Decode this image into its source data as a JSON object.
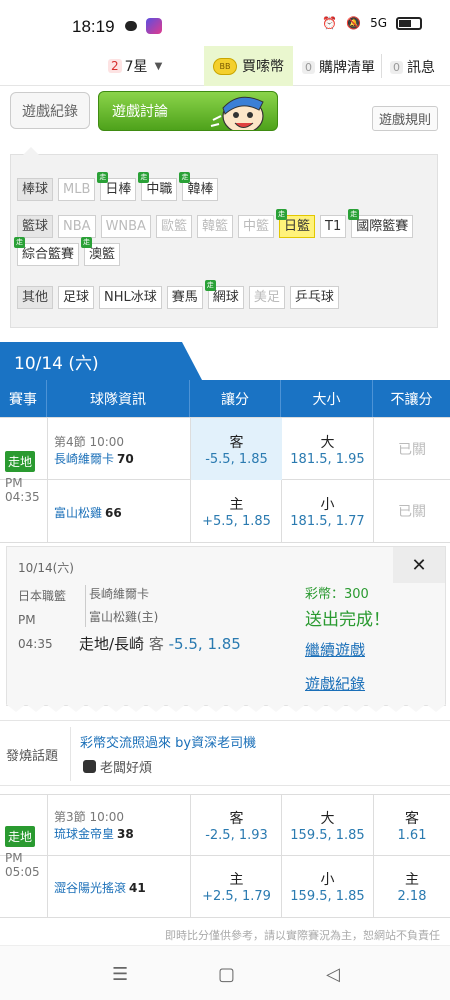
{
  "statusbar": {
    "time": "18:19",
    "signal": "5G"
  },
  "topnav": {
    "stars_count": "2",
    "stars_label": "7星",
    "buy_coin_badge": "BB",
    "buy_label": "買嗦幣",
    "sold_count": "0",
    "sold_label": "購牌清單",
    "msg_count": "0",
    "msg_label": "訊息"
  },
  "actions": {
    "record_label": "遊戲紀錄",
    "discuss_label": "遊戲討論",
    "rules_label": "遊戲規則"
  },
  "filters": {
    "rows": [
      {
        "category": "棒球",
        "items": [
          {
            "label": "MLB",
            "state": "disabled",
            "live": false
          },
          {
            "label": "日棒",
            "state": "normal",
            "live": true
          },
          {
            "label": "中職",
            "state": "normal",
            "live": true
          },
          {
            "label": "韓棒",
            "state": "normal",
            "live": true
          }
        ]
      },
      {
        "category": "籃球",
        "items": [
          {
            "label": "NBA",
            "state": "disabled",
            "live": false
          },
          {
            "label": "WNBA",
            "state": "disabled",
            "live": false
          },
          {
            "label": "歐籃",
            "state": "disabled",
            "live": false
          },
          {
            "label": "韓籃",
            "state": "disabled",
            "live": false
          },
          {
            "label": "中籃",
            "state": "disabled",
            "live": false
          },
          {
            "label": "日籃",
            "state": "selected",
            "live": true
          },
          {
            "label": "T1",
            "state": "normal",
            "live": false
          },
          {
            "label": "國際籃賽",
            "state": "normal",
            "live": true
          },
          {
            "label": "綜合籃賽",
            "state": "normal",
            "live": true
          },
          {
            "label": "澳籃",
            "state": "normal",
            "live": true
          }
        ]
      },
      {
        "category": "其他",
        "items": [
          {
            "label": "足球",
            "state": "normal",
            "live": false
          },
          {
            "label": "NHL冰球",
            "state": "normal",
            "live": false
          },
          {
            "label": "賽馬",
            "state": "normal",
            "live": false
          },
          {
            "label": "網球",
            "state": "normal",
            "live": true
          },
          {
            "label": "美足",
            "state": "disabled",
            "live": false
          },
          {
            "label": "乒乓球",
            "state": "normal",
            "live": false
          }
        ]
      }
    ],
    "live_badge": "走"
  },
  "date_tab": "10/14 (六)",
  "table_header": [
    "賽事",
    "球隊資訊",
    "讓分",
    "大小",
    "不讓分"
  ],
  "games": [
    {
      "status_badge": "走地",
      "ampm": "PM",
      "time": "04:35",
      "period": "第4節 10:00",
      "team1": "長崎維爾卡",
      "score1": "70",
      "team2": "富山松雞",
      "score2": "66",
      "row1": {
        "spread_lbl": "客",
        "spread_val": "-5.5, 1.85",
        "ou_lbl": "大",
        "ou_val": "181.5, 1.95",
        "ml": "已關"
      },
      "row2": {
        "spread_lbl": "主",
        "spread_val": "+5.5, 1.85",
        "ou_lbl": "小",
        "ou_val": "181.5, 1.77",
        "ml": "已關"
      }
    },
    {
      "status_badge": "走地",
      "ampm": "PM",
      "time": "05:05",
      "period": "第3節 10:00",
      "team1": "琉球金帝皇",
      "score1": "38",
      "team2": "澀谷陽光搖滾",
      "score2": "41",
      "row1": {
        "spread_lbl": "客",
        "spread_val": "-2.5, 1.93",
        "ou_lbl": "大",
        "ou_val": "159.5, 1.85",
        "ml_lbl": "客",
        "ml_val": "1.61"
      },
      "row2": {
        "spread_lbl": "主",
        "spread_val": "+2.5, 1.79",
        "ou_lbl": "小",
        "ou_val": "159.5, 1.85",
        "ml_lbl": "主",
        "ml_val": "2.18"
      }
    }
  ],
  "popup": {
    "date": "10/14(六)",
    "league": "日本職籃",
    "ampm": "PM",
    "time": "04:35",
    "team1": "長崎維爾卡",
    "team2": "富山松雞(主)",
    "bet_prefix": "走地/長崎",
    "bet_kind": "客",
    "bet_odds": "-5.5, 1.85",
    "coins": "彩幣：300",
    "done": "送出完成！",
    "continue": "繼續遊戲",
    "record": "遊戲紀錄",
    "close": "✕"
  },
  "hot_topic": {
    "label": "發燒話題",
    "title": "彩幣交流照過來 by資深老司機",
    "author": "老闆好煩"
  },
  "disclaimer": "即時比分僅供參考，請以實際賽況為主，恕網站不負責任",
  "androidnav": {
    "menu": "☰",
    "home": "▢",
    "back": "◁"
  }
}
